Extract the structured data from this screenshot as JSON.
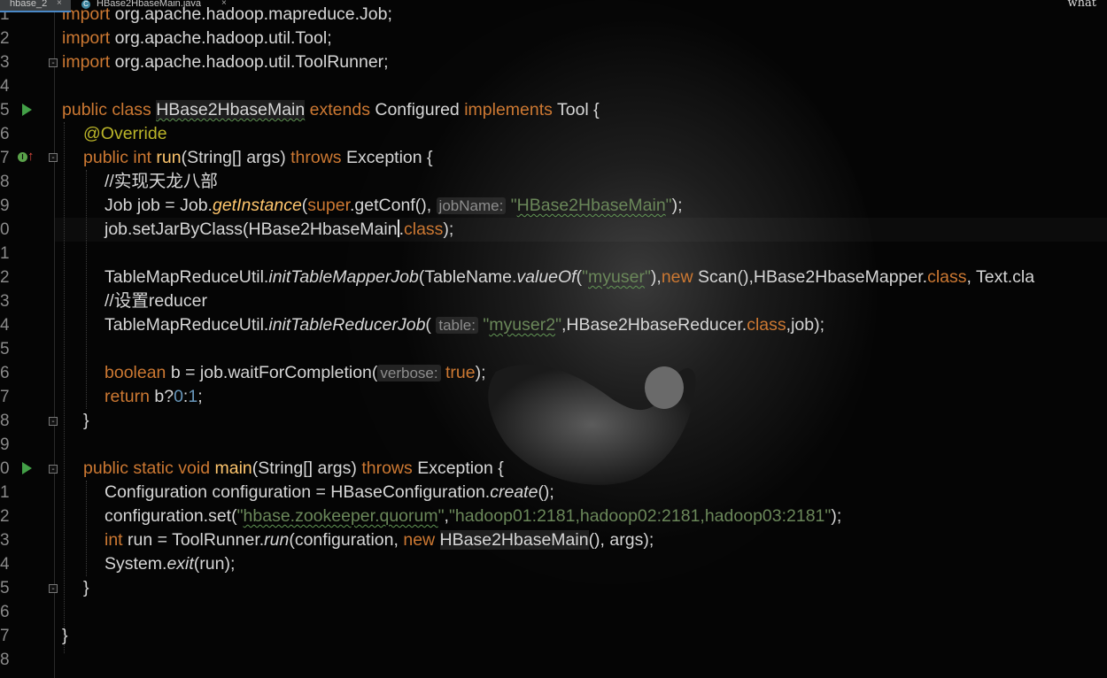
{
  "tabs": [
    {
      "label": "hbase_2",
      "close": "×"
    },
    {
      "label": "HBase2HbaseMain.java",
      "close": "×",
      "icon": "java-class-icon"
    }
  ],
  "overlay_text": "what",
  "line_numbers": [
    "1",
    "2",
    "3",
    "4",
    "5",
    "6",
    "7",
    "8",
    "9",
    "0",
    "1",
    "2",
    "3",
    "4",
    "5",
    "6",
    "7",
    "8",
    "9",
    "0",
    "1",
    "2",
    "3",
    "4",
    "5",
    "6",
    "7",
    "8"
  ],
  "code": {
    "l1": {
      "kw": "import",
      "rest": " org.apache.hadoop.mapreduce.Job;"
    },
    "l2": {
      "kw": "import",
      "rest": " org.apache.hadoop.util.Tool;"
    },
    "l3": {
      "kw": "import",
      "rest": " org.apache.hadoop.util.ToolRunner;"
    },
    "l5": {
      "kw1": "public class ",
      "name": "HBase2HbaseMain",
      "kw2": " extends ",
      "cls": "Configured",
      "kw3": " implements ",
      "iface": "Tool {"
    },
    "l6": {
      "ann": "@Override"
    },
    "l7": {
      "kw1": "public int ",
      "m": "run",
      "p": "(String[] args) ",
      "kw2": "throws ",
      "e": "Exception {"
    },
    "l8": {
      "comment": "//实现天龙八部"
    },
    "l9": {
      "a": "Job job = Job.",
      "m": "getInstance",
      "b": "(",
      "kw": "super",
      "c": ".getConf(), ",
      "hint": "jobName:",
      "str_q1": " \"",
      "str": "HBase2HbaseMain",
      "str_q2": "\"",
      "d": ");"
    },
    "l10": {
      "a": "job.setJarByClass(HBase2HbaseMain",
      "b": ".",
      "kw": "class",
      "c": ");"
    },
    "l12": {
      "a": "TableMapReduceUtil.",
      "m": "initTableMapperJob",
      "b": "(TableName.",
      "m2": "valueOf",
      "c": "(",
      "s1": "\"",
      "s": "myuser",
      "s2": "\"",
      "d": "),",
      "kw": "new",
      "e": " Scan(),HBase2HbaseMapper.",
      "kw2": "class",
      "f": ", Text.cla"
    },
    "l13": {
      "comment": "//设置reducer"
    },
    "l14": {
      "a": "TableMapReduceUtil.",
      "m": "initTableReducerJob",
      "b": "( ",
      "hint": "table:",
      "s1": " \"",
      "s": "myuser2",
      "s2": "\"",
      "c": ",HBase2HbaseReducer.",
      "kw": "class",
      "d": ",job);"
    },
    "l16": {
      "kw": "boolean",
      "a": " b = job.waitForCompletion(",
      "hint": "verbose:",
      "kw2": " true",
      "b": ");"
    },
    "l17": {
      "kw": "return",
      "a": " b?",
      "n1": "0",
      "b": ":",
      "n2": "1",
      "c": ";"
    },
    "l18": {
      "a": "}"
    },
    "l20": {
      "kw1": "public static void ",
      "m": "main",
      "p": "(String[] args) ",
      "kw2": "throws ",
      "e": "Exception {"
    },
    "l21": {
      "a": "Configuration configuration = HBaseConfiguration.",
      "m": "create",
      "b": "();"
    },
    "l22": {
      "a": "configuration.set(",
      "s1": "\"",
      "s": "hbase.zookeeper.quorum",
      "s2": "\"",
      "b": ",",
      "s3": "\"hadoop01:2181,hadoop02:2181,hadoop03:2181\"",
      "c": ");"
    },
    "l23": {
      "kw": "int",
      "a": " run = ToolRunner.",
      "m": "run",
      "b": "(configuration, ",
      "kw2": "new",
      "c": " ",
      "name": "HBase2HbaseMain",
      "d": "(), args);"
    },
    "l24": {
      "a": "System.",
      "m": "exit",
      "b": "(run);"
    },
    "l25": {
      "a": "}"
    },
    "l27": {
      "a": "}"
    }
  }
}
